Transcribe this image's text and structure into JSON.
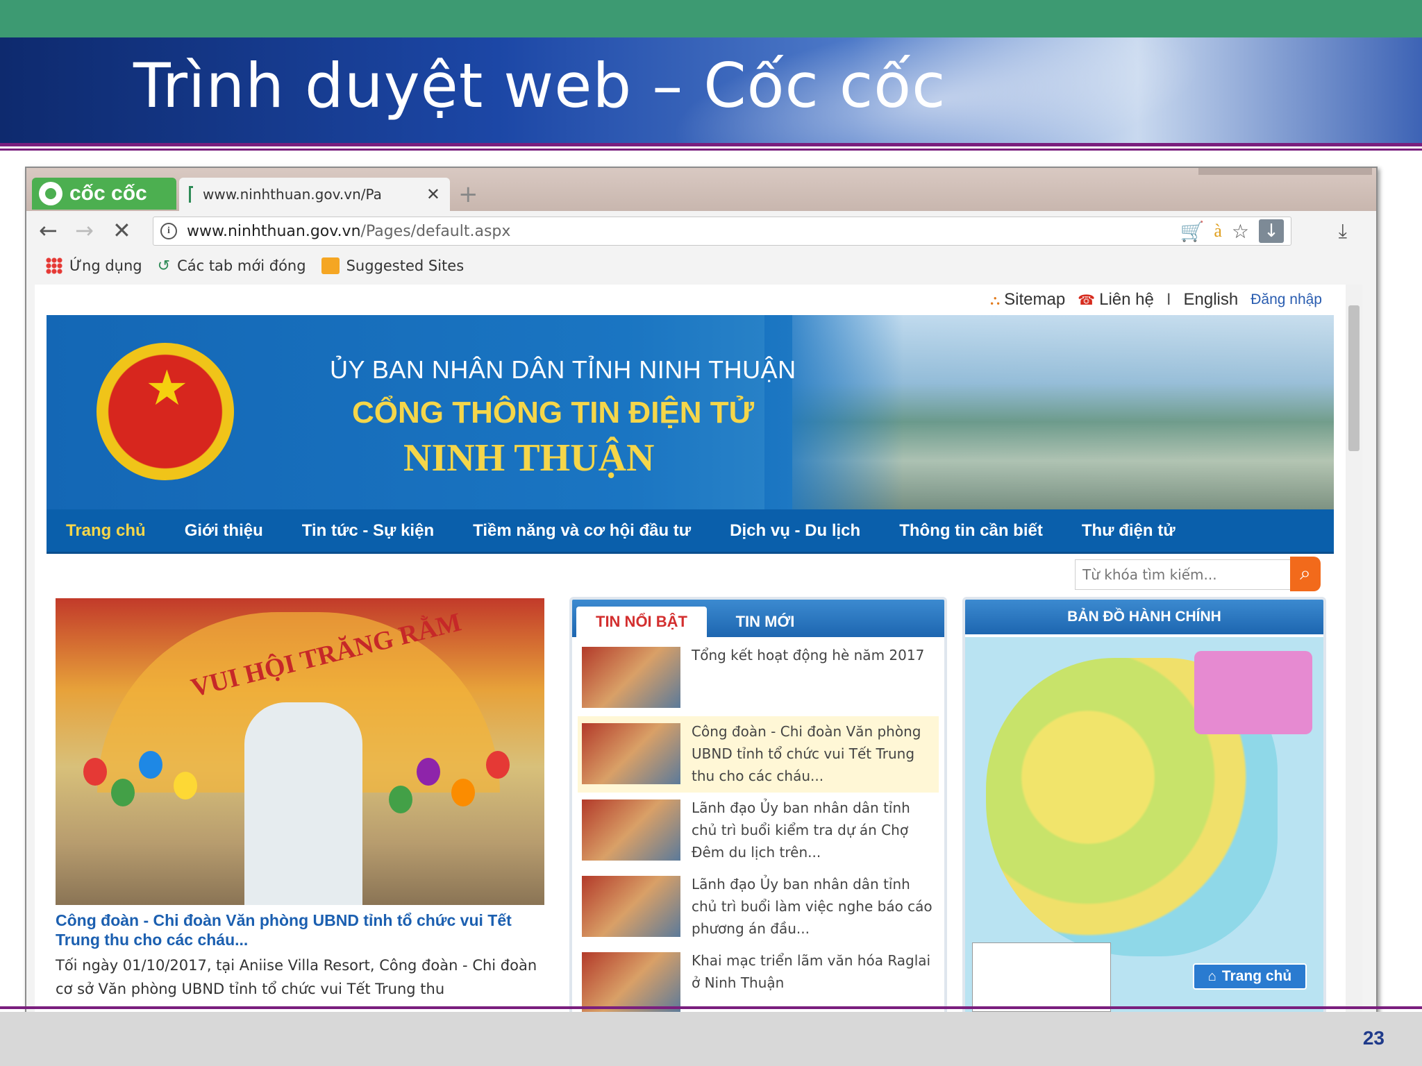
{
  "slide": {
    "title": "Trình duyệt web – Cốc cốc",
    "page_number": "23"
  },
  "browser": {
    "brand_name": "cốc cốc",
    "tab_title": "www.ninhthuan.gov.vn/Pa",
    "url_domain": "www.ninhthuan.gov.vn",
    "url_path": "/Pages/default.aspx",
    "bookmarks": [
      {
        "label": "Ứng dụng"
      },
      {
        "label": "Các tab mới đóng"
      },
      {
        "label": "Suggested Sites"
      }
    ]
  },
  "site": {
    "util": {
      "sitemap": "Sitemap",
      "contact": "Liên hệ",
      "sep": "I",
      "english": "English",
      "login": "Đăng nhập"
    },
    "banner": {
      "line1": "ỦY BAN NHÂN DÂN TỈNH NINH THUẬN",
      "line2": "CỔNG THÔNG TIN ĐIỆN TỬ",
      "line3": "NINH THUẬN"
    },
    "nav": [
      {
        "label": "Trang chủ"
      },
      {
        "label": "Giới thiệu"
      },
      {
        "label": "Tin tức - Sự kiện"
      },
      {
        "label": "Tiềm năng và cơ hội đầu tư"
      },
      {
        "label": "Dịch vụ - Du lịch"
      },
      {
        "label": "Thông tin cần biết"
      },
      {
        "label": "Thư điện tử"
      }
    ],
    "search_placeholder": "Từ khóa tìm kiếm...",
    "featured": {
      "image_caption": "VUI HỘI TRĂNG RẰM",
      "title": "Công đoàn - Chi đoàn Văn phòng UBND tỉnh tổ chức vui Tết Trung thu cho các cháu...",
      "summary": "Tối ngày 01/10/2017, tại Aniise Villa Resort, Công đoàn - Chi đoàn cơ sở Văn phòng UBND tỉnh tổ chức vui Tết Trung thu"
    },
    "news_tabs": {
      "featured": "TIN NỔI BẬT",
      "latest": "TIN MỚI"
    },
    "news": [
      {
        "title": "Tổng kết hoạt động hè năm 2017"
      },
      {
        "title": "Công đoàn - Chi đoàn Văn phòng UBND tỉnh tổ chức vui Tết Trung thu cho các cháu..."
      },
      {
        "title": "Lãnh đạo Ủy ban nhân dân tỉnh chủ trì buổi kiểm tra dự án Chợ Đêm du lịch trên..."
      },
      {
        "title": "Lãnh đạo Ủy ban nhân dân tỉnh chủ trì buổi làm việc nghe báo cáo phương án đầu..."
      },
      {
        "title": "Khai mạc triển lãm văn hóa Raglai ở Ninh Thuận"
      }
    ],
    "map": {
      "title": "BẢN ĐỒ HÀNH CHÍNH",
      "home_button": "Trang chủ"
    }
  }
}
